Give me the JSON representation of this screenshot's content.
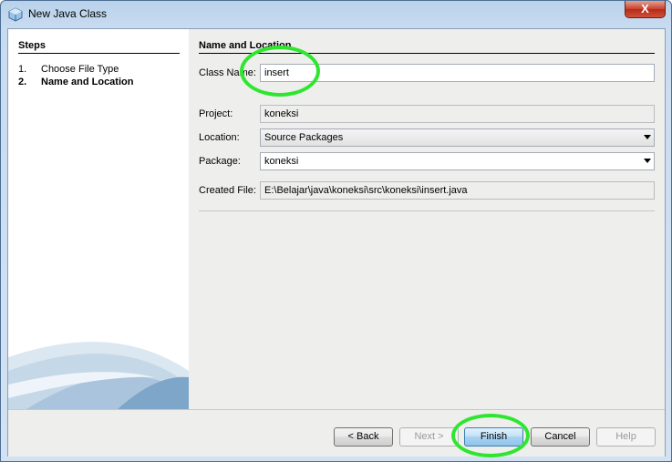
{
  "window": {
    "title": "New Java Class",
    "close_glyph": "X"
  },
  "steps": {
    "title": "Steps",
    "items": [
      {
        "num": "1.",
        "label": "Choose File Type"
      },
      {
        "num": "2.",
        "label": "Name and Location"
      }
    ]
  },
  "form": {
    "section_title": "Name and Location",
    "class_name": {
      "label": "Class Name:",
      "value": "insert"
    },
    "project": {
      "label": "Project:",
      "value": "koneksi"
    },
    "location": {
      "label": "Location:",
      "value": "Source Packages"
    },
    "package": {
      "label": "Package:",
      "value": "koneksi"
    },
    "created_file": {
      "label": "Created File:",
      "value": "E:\\Belajar\\java\\koneksi\\src\\koneksi\\insert.java"
    }
  },
  "buttons": {
    "back": "< Back",
    "next": "Next >",
    "finish": "Finish",
    "cancel": "Cancel",
    "help": "Help"
  },
  "colors": {
    "highlight": "#2fe62f",
    "default_button": "#a9d2f1"
  }
}
